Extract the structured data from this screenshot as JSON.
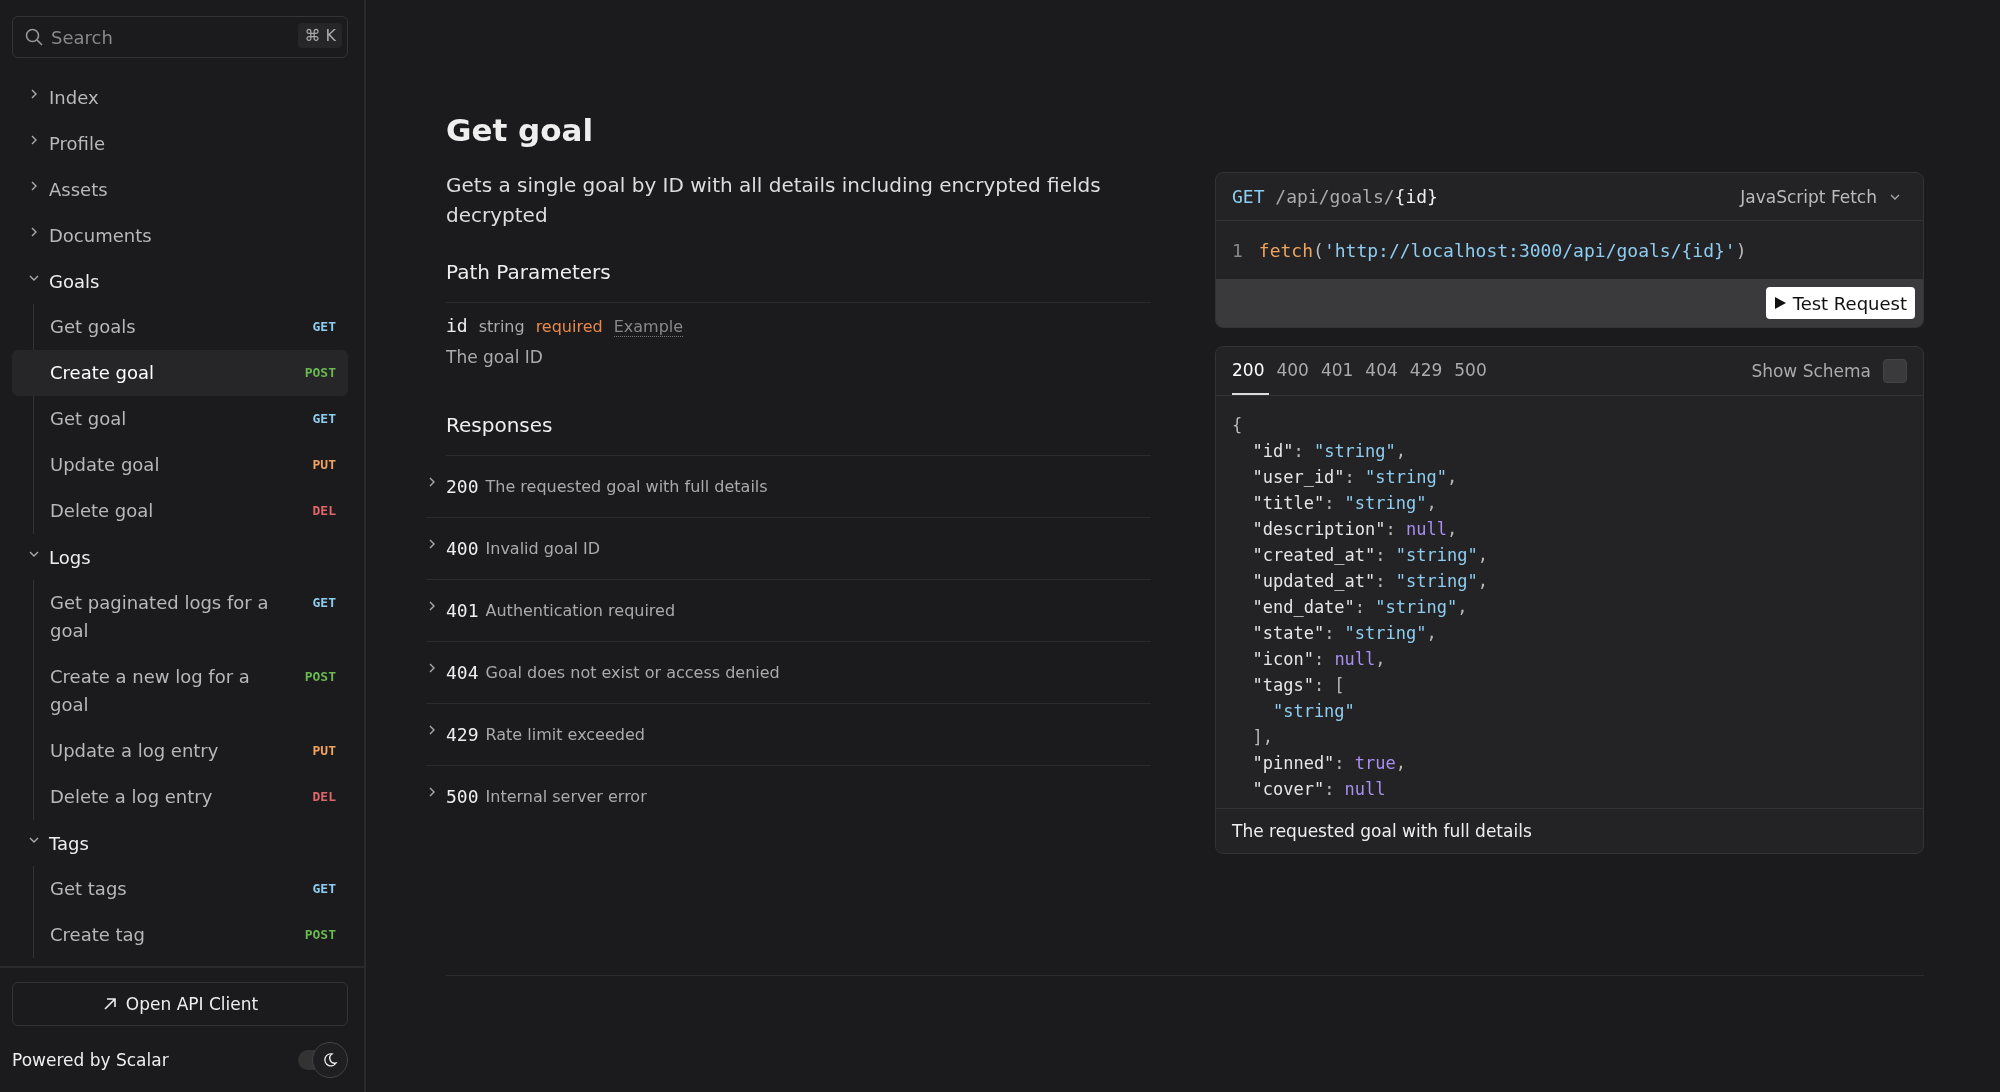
{
  "sidebar": {
    "search": {
      "placeholder": "Search",
      "shortcut": "⌘ K"
    },
    "items": [
      {
        "label": "Index",
        "expanded": false
      },
      {
        "label": "Profile",
        "expanded": false
      },
      {
        "label": "Assets",
        "expanded": false
      },
      {
        "label": "Documents",
        "expanded": false
      },
      {
        "label": "Goals",
        "expanded": true,
        "children": [
          {
            "label": "Get goals",
            "method": "GET",
            "color": "#8fcdf0",
            "selected": false
          },
          {
            "label": "Create goal",
            "method": "POST",
            "color": "#6ab850",
            "selected": true
          },
          {
            "label": "Get goal",
            "method": "GET",
            "color": "#8fcdf0",
            "selected": false
          },
          {
            "label": "Update goal",
            "method": "PUT",
            "color": "#f0a35e",
            "selected": false
          },
          {
            "label": "Delete goal",
            "method": "DEL",
            "color": "#e0666a",
            "selected": false
          }
        ]
      },
      {
        "label": "Logs",
        "expanded": true,
        "children": [
          {
            "label": "Get paginated logs for a goal",
            "method": "GET",
            "color": "#8fcdf0",
            "selected": false
          },
          {
            "label": "Create a new log for a goal",
            "method": "POST",
            "color": "#6ab850",
            "selected": false
          },
          {
            "label": "Update a log entry",
            "method": "PUT",
            "color": "#f0a35e",
            "selected": false
          },
          {
            "label": "Delete a log entry",
            "method": "DEL",
            "color": "#e0666a",
            "selected": false
          }
        ]
      },
      {
        "label": "Tags",
        "expanded": true,
        "children": [
          {
            "label": "Get tags",
            "method": "GET",
            "color": "#8fcdf0",
            "selected": false
          },
          {
            "label": "Create tag",
            "method": "POST",
            "color": "#6ab850",
            "selected": false
          }
        ]
      }
    ],
    "open_client_button": "Open API Client",
    "powered_by": "Powered by Scalar",
    "dark_mode": {
      "on": true
    }
  },
  "endpoint": {
    "title": "Get goal",
    "description": "Gets a single goal by ID with all details including encrypted fields decrypted",
    "path_parameters": {
      "heading": "Path Parameters",
      "params": [
        {
          "name": "id",
          "type": "string",
          "required": "required",
          "example": "Example",
          "description": "The goal ID"
        }
      ]
    },
    "responses": {
      "heading": "Responses",
      "items": [
        {
          "code": "200",
          "description": "The requested goal with full details",
          "expanded": false
        },
        {
          "code": "400",
          "description": "Invalid goal ID",
          "expanded": false
        },
        {
          "code": "401",
          "description": "Authentication required",
          "expanded": false
        },
        {
          "code": "404",
          "description": "Goal does not exist or access denied",
          "expanded": false
        },
        {
          "code": "429",
          "description": "Rate limit exceeded",
          "expanded": false
        },
        {
          "code": "500",
          "description": "Internal server error",
          "expanded": false
        }
      ]
    }
  },
  "request_panel": {
    "method": "GET",
    "path": "/api/goals/",
    "path_param": "{id}",
    "language": "JavaScript Fetch",
    "code_lines": [
      {
        "number": "1",
        "tokens": [
          {
            "kind": "fn",
            "text": "fetch"
          },
          {
            "kind": "punct",
            "text": "("
          },
          {
            "kind": "string",
            "text": "'http://localhost:3000/api/goals/{id}'"
          },
          {
            "kind": "punct",
            "text": ")"
          }
        ]
      }
    ],
    "test_button": "Test Request"
  },
  "response_panel": {
    "tabs": [
      {
        "label": "200",
        "selected": true
      },
      {
        "label": "400",
        "selected": false
      },
      {
        "label": "401",
        "selected": false
      },
      {
        "label": "404",
        "selected": false
      },
      {
        "label": "429",
        "selected": false
      },
      {
        "label": "500",
        "selected": false
      }
    ],
    "show_schema": {
      "label": "Show Schema",
      "checked": false
    },
    "code_lines": [
      [
        {
          "kind": "punct",
          "text": "{"
        }
      ],
      [
        {
          "kind": "key",
          "text": "  \"id\""
        },
        {
          "kind": "punct",
          "text": ": "
        },
        {
          "kind": "string",
          "text": "\"string\""
        },
        {
          "kind": "punct",
          "text": ","
        }
      ],
      [
        {
          "kind": "key",
          "text": "  \"user_id\""
        },
        {
          "kind": "punct",
          "text": ": "
        },
        {
          "kind": "string",
          "text": "\"string\""
        },
        {
          "kind": "punct",
          "text": ","
        }
      ],
      [
        {
          "kind": "key",
          "text": "  \"title\""
        },
        {
          "kind": "punct",
          "text": ": "
        },
        {
          "kind": "string",
          "text": "\"string\""
        },
        {
          "kind": "punct",
          "text": ","
        }
      ],
      [
        {
          "kind": "key",
          "text": "  \"description\""
        },
        {
          "kind": "punct",
          "text": ": "
        },
        {
          "kind": "literal",
          "text": "null"
        },
        {
          "kind": "punct",
          "text": ","
        }
      ],
      [
        {
          "kind": "key",
          "text": "  \"created_at\""
        },
        {
          "kind": "punct",
          "text": ": "
        },
        {
          "kind": "string",
          "text": "\"string\""
        },
        {
          "kind": "punct",
          "text": ","
        }
      ],
      [
        {
          "kind": "key",
          "text": "  \"updated_at\""
        },
        {
          "kind": "punct",
          "text": ": "
        },
        {
          "kind": "string",
          "text": "\"string\""
        },
        {
          "kind": "punct",
          "text": ","
        }
      ],
      [
        {
          "kind": "key",
          "text": "  \"end_date\""
        },
        {
          "kind": "punct",
          "text": ": "
        },
        {
          "kind": "string",
          "text": "\"string\""
        },
        {
          "kind": "punct",
          "text": ","
        }
      ],
      [
        {
          "kind": "key",
          "text": "  \"state\""
        },
        {
          "kind": "punct",
          "text": ": "
        },
        {
          "kind": "string",
          "text": "\"string\""
        },
        {
          "kind": "punct",
          "text": ","
        }
      ],
      [
        {
          "kind": "key",
          "text": "  \"icon\""
        },
        {
          "kind": "punct",
          "text": ": "
        },
        {
          "kind": "literal",
          "text": "null"
        },
        {
          "kind": "punct",
          "text": ","
        }
      ],
      [
        {
          "kind": "key",
          "text": "  \"tags\""
        },
        {
          "kind": "punct",
          "text": ": ["
        }
      ],
      [
        {
          "kind": "string",
          "text": "    \"string\""
        }
      ],
      [
        {
          "kind": "punct",
          "text": "  ],"
        }
      ],
      [
        {
          "kind": "key",
          "text": "  \"pinned\""
        },
        {
          "kind": "punct",
          "text": ": "
        },
        {
          "kind": "literal",
          "text": "true"
        },
        {
          "kind": "punct",
          "text": ","
        }
      ],
      [
        {
          "kind": "key",
          "text": "  \"cover\""
        },
        {
          "kind": "punct",
          "text": ": "
        },
        {
          "kind": "literal",
          "text": "null"
        }
      ]
    ],
    "footer": "The requested goal with full details"
  }
}
